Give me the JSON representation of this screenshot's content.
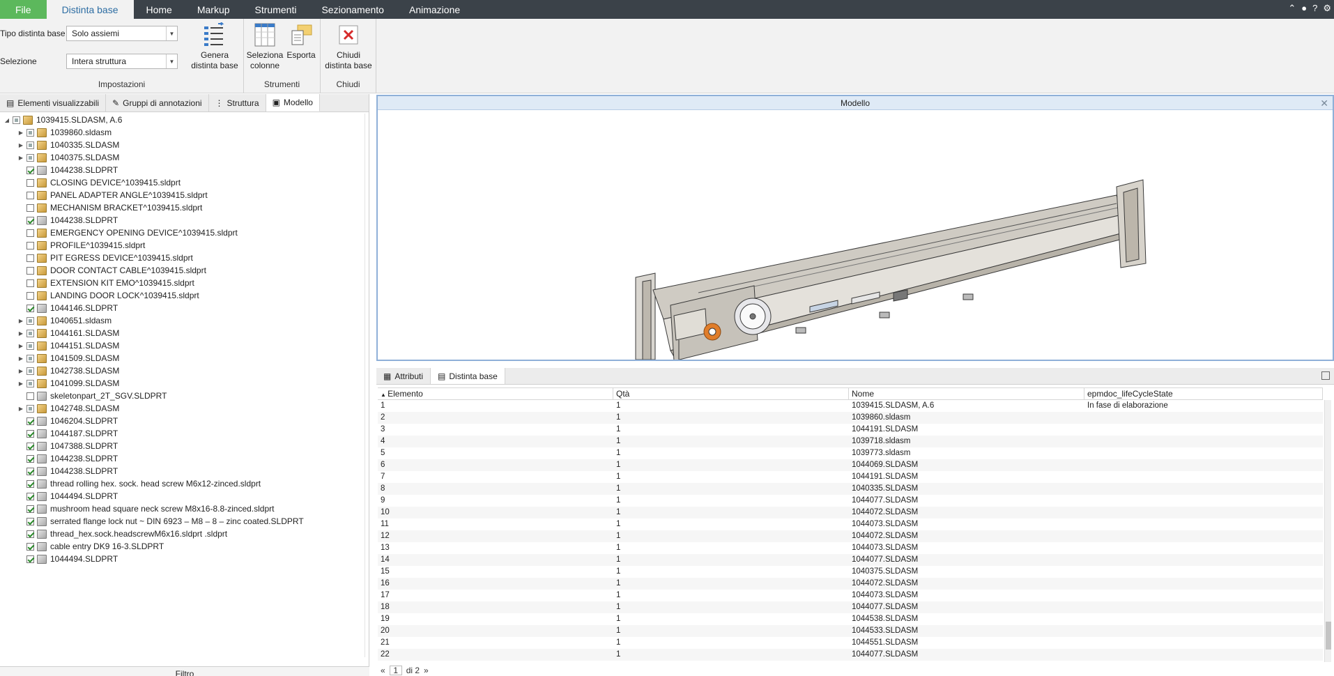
{
  "ribbon_tabs": [
    "File",
    "Distinta base",
    "Home",
    "Markup",
    "Strumenti",
    "Sezionamento",
    "Animazione"
  ],
  "ribbon": {
    "impostazioni": {
      "title": "Impostazioni",
      "tipo_label": "Tipo distinta base",
      "tipo_value": "Solo assiemi",
      "selezione_label": "Selezione",
      "selezione_value": "Intera struttura",
      "genera_line1": "Genera",
      "genera_line2": "distinta base"
    },
    "strumenti": {
      "title": "Strumenti",
      "seleziona_line1": "Seleziona",
      "seleziona_line2": "colonne",
      "esporta": "Esporta"
    },
    "chiudi": {
      "title": "Chiudi",
      "chiudi_line1": "Chiudi",
      "chiudi_line2": "distinta base"
    }
  },
  "left_tabs": [
    "Elementi visualizzabili",
    "Gruppi di annotazioni",
    "Struttura",
    "Modello"
  ],
  "tree": [
    {
      "label": "1039415.SLDASM, A.6",
      "expand": "open",
      "check": "part",
      "kind": "asm",
      "indent": 0
    },
    {
      "label": "1039860.sldasm",
      "expand": "closed",
      "check": "part",
      "kind": "asm",
      "indent": 1
    },
    {
      "label": "1040335.SLDASM",
      "expand": "closed",
      "check": "part",
      "kind": "asm",
      "indent": 1
    },
    {
      "label": "1040375.SLDASM",
      "expand": "closed",
      "check": "part",
      "kind": "asm",
      "indent": 1
    },
    {
      "label": "1044238.SLDPRT",
      "expand": "",
      "check": "on",
      "kind": "part",
      "indent": 1
    },
    {
      "label": "CLOSING DEVICE^1039415.sldprt",
      "expand": "",
      "check": "off",
      "kind": "asm",
      "indent": 1
    },
    {
      "label": "PANEL ADAPTER ANGLE^1039415.sldprt",
      "expand": "",
      "check": "off",
      "kind": "asm",
      "indent": 1
    },
    {
      "label": "MECHANISM BRACKET^1039415.sldprt",
      "expand": "",
      "check": "off",
      "kind": "asm",
      "indent": 1
    },
    {
      "label": "1044238.SLDPRT",
      "expand": "",
      "check": "on",
      "kind": "part",
      "indent": 1
    },
    {
      "label": "EMERGENCY OPENING DEVICE^1039415.sldprt",
      "expand": "",
      "check": "off",
      "kind": "asm",
      "indent": 1
    },
    {
      "label": "PROFILE^1039415.sldprt",
      "expand": "",
      "check": "off",
      "kind": "asm",
      "indent": 1
    },
    {
      "label": "PIT EGRESS DEVICE^1039415.sldprt",
      "expand": "",
      "check": "off",
      "kind": "asm",
      "indent": 1
    },
    {
      "label": "DOOR CONTACT CABLE^1039415.sldprt",
      "expand": "",
      "check": "off",
      "kind": "asm",
      "indent": 1
    },
    {
      "label": "EXTENSION KIT EMO^1039415.sldprt",
      "expand": "",
      "check": "off",
      "kind": "asm",
      "indent": 1
    },
    {
      "label": "LANDING DOOR LOCK^1039415.sldprt",
      "expand": "",
      "check": "off",
      "kind": "asm",
      "indent": 1
    },
    {
      "label": "1044146.SLDPRT",
      "expand": "",
      "check": "on",
      "kind": "part",
      "indent": 1
    },
    {
      "label": "1040651.sldasm",
      "expand": "closed",
      "check": "part",
      "kind": "asm",
      "indent": 1
    },
    {
      "label": "1044161.SLDASM",
      "expand": "closed",
      "check": "part",
      "kind": "asm",
      "indent": 1
    },
    {
      "label": "1044151.SLDASM",
      "expand": "closed",
      "check": "part",
      "kind": "asm",
      "indent": 1
    },
    {
      "label": "1041509.SLDASM",
      "expand": "closed",
      "check": "part",
      "kind": "asm",
      "indent": 1
    },
    {
      "label": "1042738.SLDASM",
      "expand": "closed",
      "check": "part",
      "kind": "asm",
      "indent": 1
    },
    {
      "label": "1041099.SLDASM",
      "expand": "closed",
      "check": "part",
      "kind": "asm",
      "indent": 1
    },
    {
      "label": "skeletonpart_2T_SGV.SLDPRT",
      "expand": "",
      "check": "off",
      "kind": "part",
      "indent": 1
    },
    {
      "label": "1042748.SLDASM",
      "expand": "closed",
      "check": "part",
      "kind": "asm",
      "indent": 1
    },
    {
      "label": "1046204.SLDPRT",
      "expand": "",
      "check": "on",
      "kind": "part",
      "indent": 1
    },
    {
      "label": "1044187.SLDPRT",
      "expand": "",
      "check": "on",
      "kind": "part",
      "indent": 1
    },
    {
      "label": "1047388.SLDPRT",
      "expand": "",
      "check": "on",
      "kind": "part",
      "indent": 1
    },
    {
      "label": "1044238.SLDPRT",
      "expand": "",
      "check": "on",
      "kind": "part",
      "indent": 1
    },
    {
      "label": "1044238.SLDPRT",
      "expand": "",
      "check": "on",
      "kind": "part",
      "indent": 1
    },
    {
      "label": "thread rolling hex. sock. head screw M6x12-zinced.sldprt",
      "expand": "",
      "check": "on",
      "kind": "part",
      "indent": 1
    },
    {
      "label": "1044494.SLDPRT",
      "expand": "",
      "check": "on",
      "kind": "part",
      "indent": 1
    },
    {
      "label": "mushroom head square neck screw M8x16-8.8-zinced.sldprt",
      "expand": "",
      "check": "on",
      "kind": "part",
      "indent": 1
    },
    {
      "label": "serrated flange lock nut ~ DIN 6923 – M8 – 8 – zinc coated.SLDPRT",
      "expand": "",
      "check": "on",
      "kind": "part",
      "indent": 1
    },
    {
      "label": "thread_hex.sock.headscrewM6x16.sldprt .sldprt",
      "expand": "",
      "check": "on",
      "kind": "part",
      "indent": 1
    },
    {
      "label": "cable entry DK9 16-3.SLDPRT",
      "expand": "",
      "check": "on",
      "kind": "part",
      "indent": 1
    },
    {
      "label": "1044494.SLDPRT",
      "expand": "",
      "check": "on",
      "kind": "part",
      "indent": 1
    }
  ],
  "filter_label": "Filtro",
  "model_title": "Modello",
  "bom_tabs": [
    "Attributi",
    "Distinta base"
  ],
  "bom_columns": [
    "Elemento",
    "Qtà",
    "Nome",
    "epmdoc_lifeCycleState"
  ],
  "bom_rows": [
    [
      "1",
      "1",
      "1039415.SLDASM, A.6",
      "In fase di elaborazione"
    ],
    [
      "2",
      "1",
      "1039860.sldasm",
      ""
    ],
    [
      "3",
      "1",
      "1044191.SLDASM",
      ""
    ],
    [
      "4",
      "1",
      "1039718.sldasm",
      ""
    ],
    [
      "5",
      "1",
      "1039773.sldasm",
      ""
    ],
    [
      "6",
      "1",
      "1044069.SLDASM",
      ""
    ],
    [
      "7",
      "1",
      "1044191.SLDASM",
      ""
    ],
    [
      "8",
      "1",
      "1040335.SLDASM",
      ""
    ],
    [
      "9",
      "1",
      "1044077.SLDASM",
      ""
    ],
    [
      "10",
      "1",
      "1044072.SLDASM",
      ""
    ],
    [
      "11",
      "1",
      "1044073.SLDASM",
      ""
    ],
    [
      "12",
      "1",
      "1044072.SLDASM",
      ""
    ],
    [
      "13",
      "1",
      "1044073.SLDASM",
      ""
    ],
    [
      "14",
      "1",
      "1044077.SLDASM",
      ""
    ],
    [
      "15",
      "1",
      "1040375.SLDASM",
      ""
    ],
    [
      "16",
      "1",
      "1044072.SLDASM",
      ""
    ],
    [
      "17",
      "1",
      "1044073.SLDASM",
      ""
    ],
    [
      "18",
      "1",
      "1044077.SLDASM",
      ""
    ],
    [
      "19",
      "1",
      "1044538.SLDASM",
      ""
    ],
    [
      "20",
      "1",
      "1044533.SLDASM",
      ""
    ],
    [
      "21",
      "1",
      "1044551.SLDASM",
      ""
    ],
    [
      "22",
      "1",
      "1044077.SLDASM",
      ""
    ]
  ],
  "pager": {
    "prev": "«",
    "page": "1",
    "of": "di 2",
    "next": "»"
  },
  "colors": {
    "tabbar": "#3b4249",
    "file_tab": "#5cb85c",
    "active_tab_text": "#2d6da3",
    "model_border": "#8fb0d8"
  },
  "icons": [
    "genera-bom-icon",
    "seleziona-colonne-icon",
    "esporta-icon",
    "chiudi-x-icon",
    "cube-icon",
    "checkbox-icon"
  ]
}
